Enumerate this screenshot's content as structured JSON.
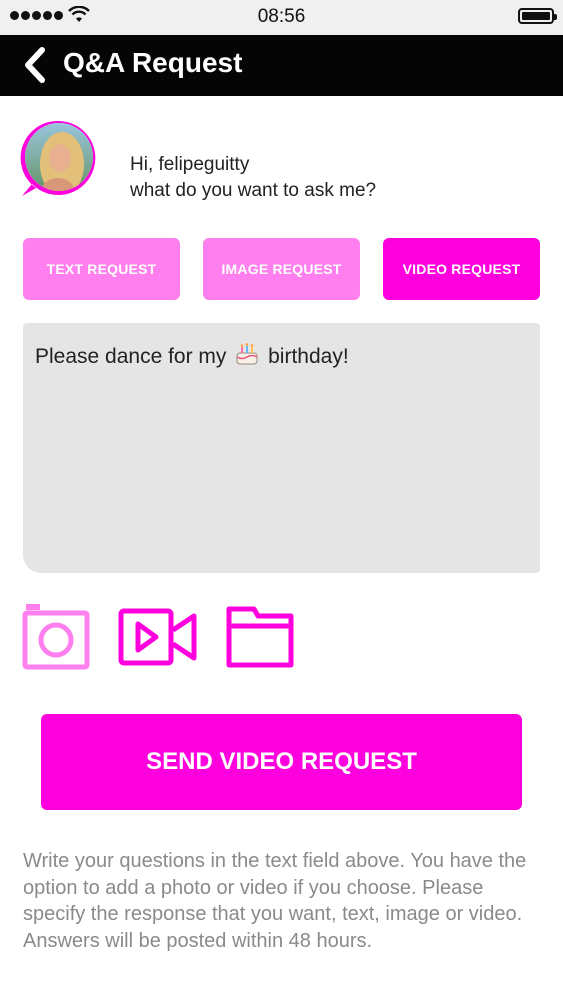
{
  "status_bar": {
    "time": "08:56"
  },
  "nav": {
    "title": "Q&A Request",
    "back_icon": "chevron-left-icon"
  },
  "greeting": {
    "line1": "Hi, felipeguitty",
    "line2": "what do you want to ask me?"
  },
  "request_types": [
    {
      "label": "TEXT REQUEST",
      "selected": false
    },
    {
      "label": "IMAGE REQUEST",
      "selected": false
    },
    {
      "label": "VIDEO REQUEST",
      "selected": true
    }
  ],
  "question": {
    "text_before": "Please dance for my",
    "text_after": "birthday!",
    "emoji": "birthday-cake-icon"
  },
  "attachments": [
    {
      "icon": "camera-icon"
    },
    {
      "icon": "video-camera-icon"
    },
    {
      "icon": "folder-icon"
    }
  ],
  "send_button": {
    "label": "SEND VIDEO REQUEST"
  },
  "help": {
    "line1": "Write your questions in the text field above. You have the option to add a photo or video if you choose. Please specify the response that you want, text, image or video.",
    "line2": "Answers will be posted within 48 hours."
  },
  "colors": {
    "accent": "#fe00dd",
    "accent_light": "#ff7fee",
    "nav_background": "#050505",
    "field_background": "#e5e5e5",
    "help_text": "#8a8a8a"
  }
}
